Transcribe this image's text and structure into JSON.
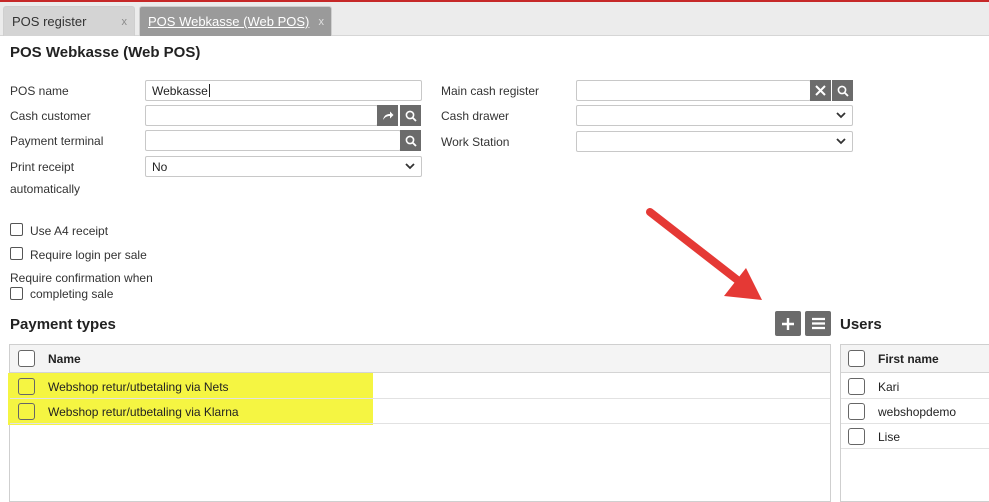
{
  "tabs": [
    {
      "label": "POS register",
      "close": "x"
    },
    {
      "label": "POS Webkasse (Web POS)",
      "close": "x"
    }
  ],
  "page_title": "POS Webkasse (Web POS)",
  "form": {
    "pos_name_label": "POS name",
    "pos_name_value": "Webkasse",
    "cash_customer_label": "Cash customer",
    "cash_customer_value": "",
    "payment_terminal_label": "Payment terminal",
    "payment_terminal_value": "",
    "print_receipt_label_1": "Print receipt",
    "print_receipt_label_2": "automatically",
    "print_receipt_value": "No",
    "main_cash_register_label": "Main cash register",
    "main_cash_register_value": "",
    "cash_drawer_label": "Cash drawer",
    "cash_drawer_value": "",
    "work_station_label": "Work Station",
    "work_station_value": ""
  },
  "options": {
    "use_a4_label": "Use A4 receipt",
    "require_login_label": "Require login per sale",
    "require_confirmation_label_1": "Require confirmation when",
    "require_confirmation_label_2": "completing sale"
  },
  "payment_types": {
    "title": "Payment types",
    "column_name": "Name",
    "rows": [
      {
        "name": "Webshop retur/utbetaling via Nets",
        "highlighted": true
      },
      {
        "name": "Webshop retur/utbetaling via Klarna",
        "highlighted": true
      }
    ]
  },
  "users": {
    "title": "Users",
    "column_first_name": "First name",
    "rows": [
      {
        "first_name": "Kari"
      },
      {
        "first_name": "webshopdemo"
      },
      {
        "first_name": "Lise"
      }
    ]
  },
  "icons": {
    "add": "plus-icon",
    "list": "list-icon",
    "arrow": "annotation-arrow"
  },
  "colors": {
    "highlight": "#f5f542",
    "arrow": "#e53935",
    "button": "#6b6b6b"
  }
}
